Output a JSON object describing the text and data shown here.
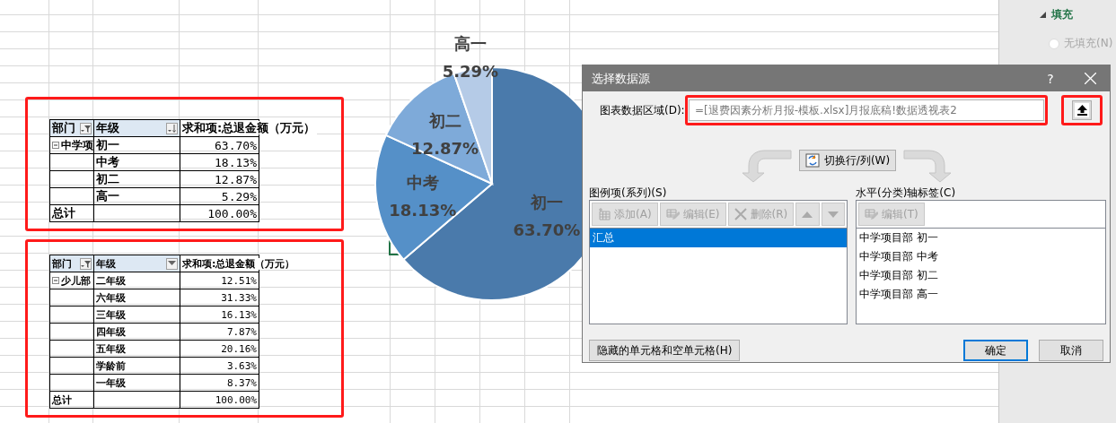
{
  "pivot_tables": [
    {
      "kind": "large",
      "header": [
        {
          "label": "部门",
          "kind": "filter"
        },
        {
          "label": "年级",
          "kind": "sort"
        },
        {
          "label": "求和项:总退金额（万元）",
          "kind": "plain"
        }
      ],
      "rows": [
        {
          "kind": "group",
          "dept": "中学项",
          "grade": "初一",
          "value": "63.70%",
          "expanded": true
        },
        {
          "kind": "item",
          "grade": "中考",
          "value": "18.13%"
        },
        {
          "kind": "item",
          "grade": "初二",
          "value": "12.87%"
        },
        {
          "kind": "item",
          "grade": "高一",
          "value": "5.29%"
        },
        {
          "kind": "total",
          "dept": "总计",
          "value": "100.00%"
        }
      ]
    },
    {
      "kind": "small",
      "header": [
        {
          "label": "部门",
          "kind": "filter"
        },
        {
          "label": "年级",
          "kind": "dropdown"
        },
        {
          "label": "求和项:总退金额（万元）",
          "kind": "plain"
        }
      ],
      "rows": [
        {
          "kind": "group",
          "dept": "少儿部",
          "grade": "二年级",
          "value": "12.51%",
          "expanded": true
        },
        {
          "kind": "item",
          "grade": "六年级",
          "value": "31.33%"
        },
        {
          "kind": "item",
          "grade": "三年级",
          "value": "16.13%"
        },
        {
          "kind": "item",
          "grade": "四年级",
          "value": "7.87%"
        },
        {
          "kind": "item",
          "grade": "五年级",
          "value": "20.16%"
        },
        {
          "kind": "item",
          "grade": "学龄前",
          "value": "3.63%"
        },
        {
          "kind": "item",
          "grade": "一年级",
          "value": "8.37%"
        },
        {
          "kind": "total",
          "dept": "总计",
          "value": "100.00%"
        }
      ]
    }
  ],
  "chart": {
    "chart_data": {
      "type": "pie",
      "categories": [
        "初一",
        "中考",
        "初二",
        "高一"
      ],
      "values": [
        63.7,
        18.13,
        12.87,
        5.29
      ],
      "colors": [
        "#4a7aab",
        "#5590c8",
        "#7eaad9",
        "#b5cbe7"
      ],
      "value_labels": [
        "63.70%",
        "18.13%",
        "12.87%",
        "5.29%"
      ]
    }
  },
  "format_pane": {
    "section": {
      "title": "填充",
      "expanded": true
    },
    "options": [
      {
        "label": "无填充(N)",
        "selected": false
      }
    ]
  },
  "dialog": {
    "title": "选择数据源",
    "help": "?",
    "range_label": "图表数据区域(D):",
    "range_value": "=[退费因素分析月报-模板.xlsx]月报底稿!数据透视表2",
    "switch_button": "切换行/列(W)",
    "legend_label": "图例项(系列)(S)",
    "legend_toolbar": [
      {
        "kind": "add",
        "label": "添加(A)",
        "disabled": true
      },
      {
        "kind": "edit",
        "label": "编辑(E)",
        "disabled": true
      },
      {
        "kind": "delete",
        "label": "删除(R)",
        "disabled": true
      },
      {
        "kind": "up",
        "disabled": true
      },
      {
        "kind": "down",
        "disabled": true
      }
    ],
    "legend_items": [
      {
        "label": "汇总",
        "selected": true
      }
    ],
    "axis_label": "水平(分类)轴标签(C)",
    "axis_toolbar": [
      {
        "kind": "edit",
        "label": "编辑(T)",
        "disabled": true
      }
    ],
    "axis_items": [
      {
        "label": "中学项目部 初一",
        "selected": false
      },
      {
        "label": "中学项目部 中考",
        "selected": false
      },
      {
        "label": "中学项目部 初二",
        "selected": false
      },
      {
        "label": "中学项目部 高一",
        "selected": false
      }
    ],
    "hidden_cells_button": "隐藏的单元格和空单元格(H)",
    "buttons": [
      {
        "label": "确定",
        "default": true
      },
      {
        "label": "取消",
        "default": false
      }
    ]
  }
}
